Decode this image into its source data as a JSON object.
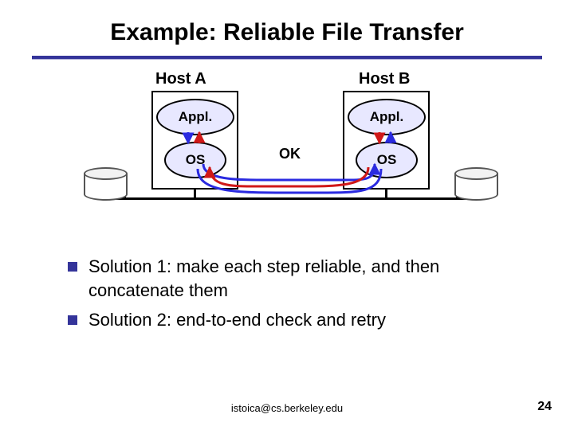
{
  "title": "Example: Reliable File Transfer",
  "diagram": {
    "host_a_label": "Host A",
    "host_b_label": "Host B",
    "appl_a": "Appl.",
    "appl_b": "Appl.",
    "os_a": "OS",
    "os_b": "OS",
    "ok_label": "OK"
  },
  "bullets": [
    "Solution 1: make each step reliable, and then concatenate them",
    "Solution 2: end-to-end check and retry"
  ],
  "footer": "istoica@cs.berkeley.edu",
  "page_number": "24"
}
